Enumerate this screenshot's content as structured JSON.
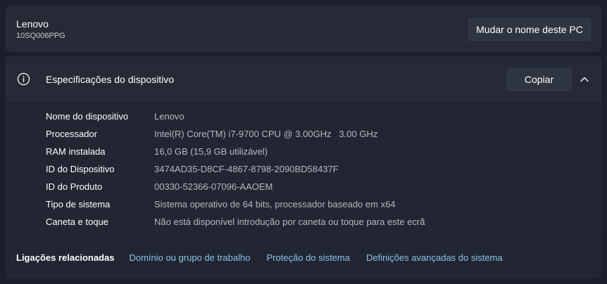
{
  "device": {
    "name": "Lenovo",
    "model": "10SQ006PPG",
    "rename_button": "Mudar o nome deste PC"
  },
  "specs": {
    "title": "Especificações do dispositivo",
    "copy_button": "Copiar",
    "rows": [
      {
        "label": "Nome do dispositivo",
        "value": "Lenovo"
      },
      {
        "label": "Processador",
        "value": "Intel(R) Core(TM) i7-9700 CPU @ 3.00GHz   3.00 GHz"
      },
      {
        "label": "RAM instalada",
        "value": "16,0 GB (15,9 GB utilizável)"
      },
      {
        "label": "ID do Dispositivo",
        "value": "3474AD35-D8CF-4867-8798-2090BD58437F"
      },
      {
        "label": "ID do Produto",
        "value": "00330-52366-07096-AAOEM"
      },
      {
        "label": "Tipo de sistema",
        "value": "Sistema operativo de 64 bits, processador baseado em x64"
      },
      {
        "label": "Caneta e toque",
        "value": "Não está disponível introdução por caneta ou toque para este ecrã"
      }
    ]
  },
  "related": {
    "title": "Ligações relacionadas",
    "links": [
      "Domínio ou grupo de trabalho",
      "Proteção do sistema",
      "Definições avançadas do sistema"
    ]
  },
  "icons": {
    "info": "info-icon",
    "chevron": "chevron-up-icon"
  },
  "colors": {
    "background": "#1a1f2b",
    "card": "#252a36",
    "link": "#8fc3ea"
  }
}
